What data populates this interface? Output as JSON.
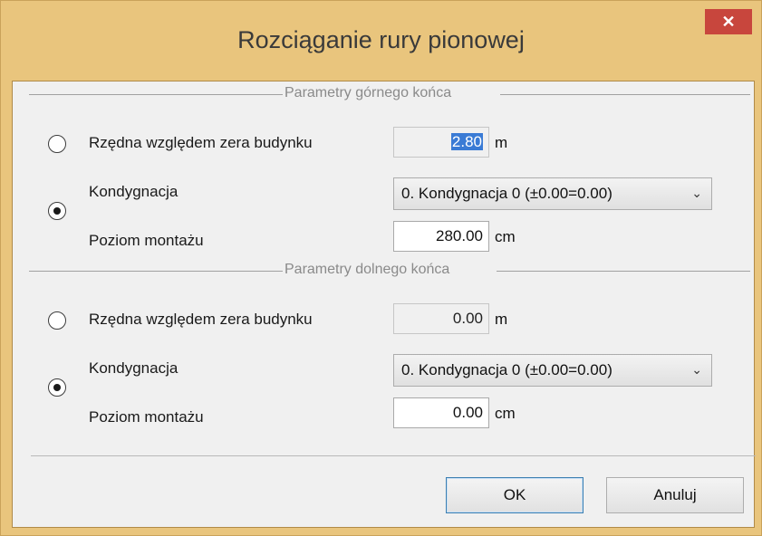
{
  "dialog": {
    "title": "Rozciąganie rury pionowej",
    "close_glyph": "✕"
  },
  "top_group": {
    "title": "Parametry górnego końca",
    "elevation_label": "Rzędna względem zera budynku",
    "elevation_value": "2.80",
    "elevation_unit": "m",
    "elevation_selected": false,
    "storey_label": "Kondygnacja",
    "storey_value": "0. Kondygnacja 0 (±0.00=0.00)",
    "storey_selected": true,
    "mount_label": "Poziom montażu",
    "mount_value": "280.00",
    "mount_unit": "cm"
  },
  "bottom_group": {
    "title": "Parametry dolnego końca",
    "elevation_label": "Rzędna względem zera budynku",
    "elevation_value": "0.00",
    "elevation_unit": "m",
    "elevation_selected": false,
    "storey_label": "Kondygnacja",
    "storey_value": "0. Kondygnacja 0 (±0.00=0.00)",
    "storey_selected": true,
    "mount_label": "Poziom montażu",
    "mount_value": "0.00",
    "mount_unit": "cm"
  },
  "buttons": {
    "ok_label": "OK",
    "cancel_label": "Anuluj"
  },
  "icons": {
    "close": "close-icon",
    "dropdown": "chevron-down-icon"
  },
  "colors": {
    "frame": "#e9c57d",
    "close_button": "#c8463d",
    "selection": "#3a7bd5"
  }
}
